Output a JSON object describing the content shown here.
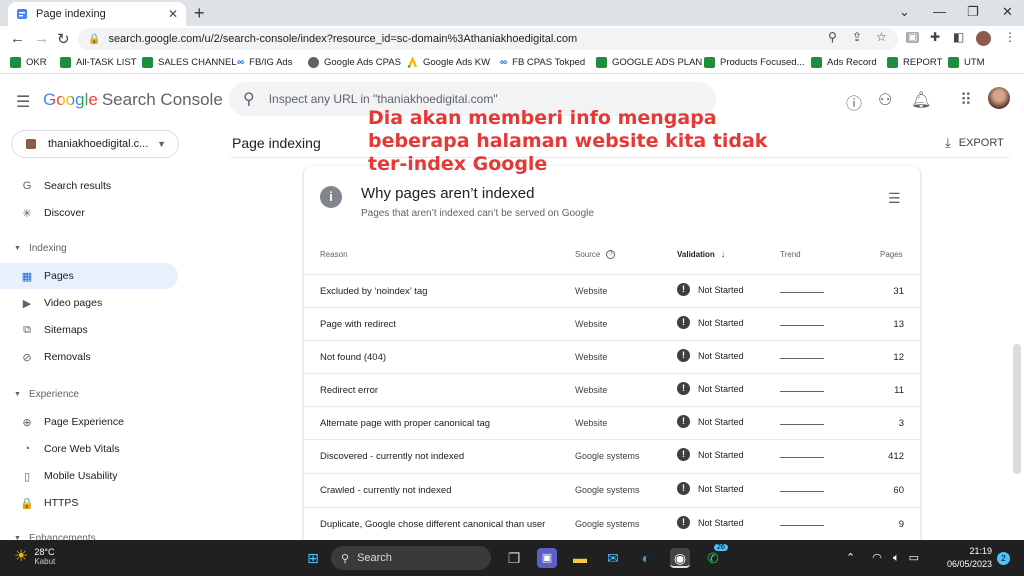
{
  "browser": {
    "tab_title": "Page indexing",
    "url": "search.google.com/u/2/search-console/index?resource_id=sc-domain%3Athaniakhoedigital.com",
    "bookmarks": [
      "OKR",
      "All-TASK LIST",
      "SALES CHANNEL",
      "FB/IG Ads",
      "Google Ads CPAS",
      "Google Ads KW",
      "FB CPAS Tokped",
      "GOOGLE ADS PLAN",
      "Products Focused...",
      "Ads Record",
      "REPORT",
      "UTM"
    ]
  },
  "header": {
    "logo_google": "Google",
    "logo_product": "Search Console",
    "inspect_placeholder": "Inspect any URL in \"thaniakhoedigital.com\""
  },
  "sidebar": {
    "property": "thaniakhoedigital.c...",
    "items_top": [
      {
        "label": "Search results",
        "icon": "G"
      },
      {
        "label": "Discover",
        "icon": "✳"
      }
    ],
    "section_indexing": "Indexing",
    "items_indexing": [
      {
        "label": "Pages",
        "icon": "▦"
      },
      {
        "label": "Video pages",
        "icon": "▶"
      },
      {
        "label": "Sitemaps",
        "icon": "⧉"
      },
      {
        "label": "Removals",
        "icon": "⊘"
      }
    ],
    "section_experience": "Experience",
    "items_experience": [
      {
        "label": "Page Experience",
        "icon": "⊕"
      },
      {
        "label": "Core Web Vitals",
        "icon": "◔"
      },
      {
        "label": "Mobile Usability",
        "icon": "▯"
      },
      {
        "label": "HTTPS",
        "icon": "🔒"
      }
    ],
    "section_enhancements": "Enhancements"
  },
  "main": {
    "page_title": "Page indexing",
    "export_label": "EXPORT",
    "annotation": "Dia akan memberi info mengapa beberapa halaman website kita tidak ter-index Google",
    "card": {
      "title": "Why pages aren’t indexed",
      "subtitle": "Pages that aren’t indexed can’t be served on Google",
      "columns": {
        "reason": "Reason",
        "source": "Source",
        "validation": "Validation",
        "trend": "Trend",
        "pages": "Pages"
      },
      "rows": [
        {
          "reason": "Excluded by ‘noindex’ tag",
          "source": "Website",
          "validation": "Not Started",
          "pages": "31"
        },
        {
          "reason": "Page with redirect",
          "source": "Website",
          "validation": "Not Started",
          "pages": "13"
        },
        {
          "reason": "Not found (404)",
          "source": "Website",
          "validation": "Not Started",
          "pages": "12"
        },
        {
          "reason": "Redirect error",
          "source": "Website",
          "validation": "Not Started",
          "pages": "11"
        },
        {
          "reason": "Alternate page with proper canonical tag",
          "source": "Website",
          "validation": "Not Started",
          "pages": "3"
        },
        {
          "reason": "Discovered - currently not indexed",
          "source": "Google systems",
          "validation": "Not Started",
          "pages": "412"
        },
        {
          "reason": "Crawled - currently not indexed",
          "source": "Google systems",
          "validation": "Not Started",
          "pages": "60"
        },
        {
          "reason": "Duplicate, Google chose different canonical than user",
          "source": "Google systems",
          "validation": "Not Started",
          "pages": "9"
        }
      ]
    }
  },
  "taskbar": {
    "temperature": "28°C",
    "weather": "Kabut",
    "search_label": "Search",
    "whatsapp_badge": "26",
    "time": "21:19",
    "date": "06/05/2023",
    "notification_count": "2"
  },
  "colors": {
    "annotation_red": "#e53935",
    "active_nav_bg": "#e8f0fe",
    "taskbar_bg": "#202020"
  }
}
